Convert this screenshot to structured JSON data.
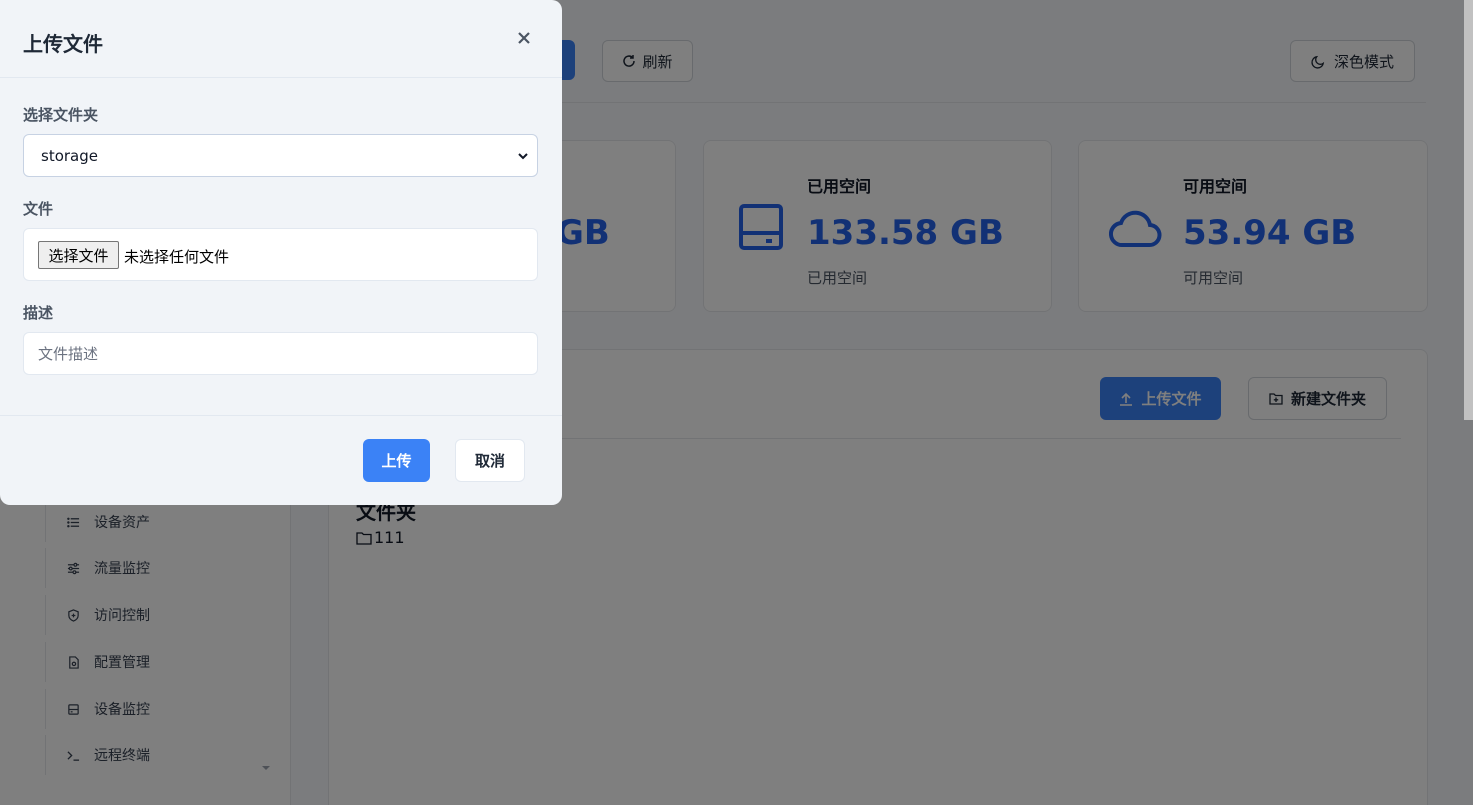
{
  "header": {
    "refresh_label": "刷新",
    "dark_mode_label": "深色模式"
  },
  "sidebar": {
    "items": [
      {
        "label": "设备资产",
        "icon": "list-icon"
      },
      {
        "label": "流量监控",
        "icon": "sliders-icon"
      },
      {
        "label": "访问控制",
        "icon": "shield-icon"
      },
      {
        "label": "配置管理",
        "icon": "file-gear-icon"
      },
      {
        "label": "设备监控",
        "icon": "panel-icon"
      },
      {
        "label": "远程终端",
        "icon": "terminal-icon"
      }
    ]
  },
  "stats": [
    {
      "title": "",
      "value": "GB",
      "sub": "",
      "icon": "drive-icon"
    },
    {
      "title": "已用空间",
      "value": "133.58 GB",
      "sub": "已用空间",
      "icon": "hard-drive-icon"
    },
    {
      "title": "可用空间",
      "value": "53.94 GB",
      "sub": "可用空间",
      "icon": "cloud-icon"
    }
  ],
  "files_panel": {
    "upload_label": "上传文件",
    "new_folder_label": "新建文件夹",
    "section_title": "文件夹",
    "folders": [
      {
        "name": "111"
      }
    ]
  },
  "modal": {
    "title": "上传文件",
    "folder_label": "选择文件夹",
    "folder_value": "storage",
    "file_label": "文件",
    "file_button": "选择文件",
    "file_status": "未选择任何文件",
    "desc_label": "描述",
    "desc_placeholder": "文件描述",
    "submit_label": "上传",
    "cancel_label": "取消"
  },
  "colors": {
    "accent": "#3b82f6",
    "stat_value": "#2563eb",
    "overlay": "rgba(0,0,0,0.5)"
  }
}
